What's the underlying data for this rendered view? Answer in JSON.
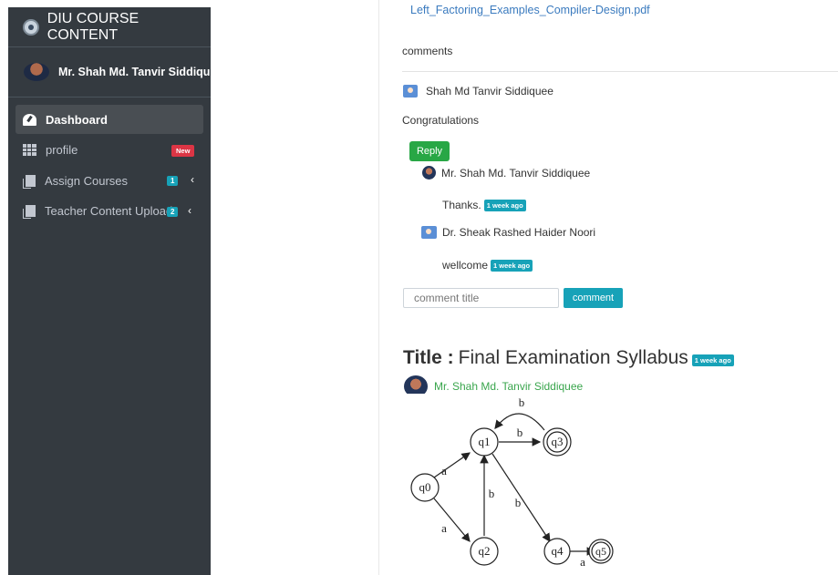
{
  "sidebar": {
    "brand": "DIU COURSE CONTENT",
    "user_name": "Mr. Shah Md. Tanvir Siddiqu",
    "items": [
      {
        "label": "Dashboard",
        "icon": "dashboard-icon"
      },
      {
        "label": "profile",
        "icon": "grid-icon",
        "badge": "New"
      },
      {
        "label": "Assign Courses",
        "icon": "copy-icon",
        "badge": "1"
      },
      {
        "label": "Teacher Content Upload",
        "icon": "copy-icon",
        "badge": "2"
      }
    ]
  },
  "main": {
    "attachment": "Left_Factoring_Examples_Compiler-Design.pdf",
    "comments_heading": "comments",
    "comment": {
      "author": "Shah Md Tanvir Siddiquee",
      "text": "Congratulations",
      "reply_label": "Reply",
      "replies": [
        {
          "author": "Mr. Shah Md. Tanvir Siddiquee",
          "text": "Thanks.",
          "time": "1 week ago"
        },
        {
          "author": "Dr. Sheak Rashed Haider Noori",
          "text": "wellcome",
          "time": "1 week ago"
        }
      ]
    },
    "comment_input_placeholder": "comment title",
    "comment_button": "comment",
    "post": {
      "title_label": "Title :",
      "title": "Final Examination Syllabus",
      "time": "1 week ago",
      "author": "Mr. Shah Md. Tanvir Siddiquee"
    },
    "diagram": {
      "states": [
        "q0",
        "q1",
        "q2",
        "q3",
        "q4",
        "q5"
      ],
      "edges": [
        "a",
        "a",
        "b",
        "b",
        "b",
        "b",
        "a"
      ]
    }
  },
  "colors": {
    "sidebar_bg": "#343a40",
    "accent_info": "#17a2b8",
    "accent_success": "#28a745",
    "accent_danger": "#dc3545",
    "link": "#3b7bbf"
  }
}
